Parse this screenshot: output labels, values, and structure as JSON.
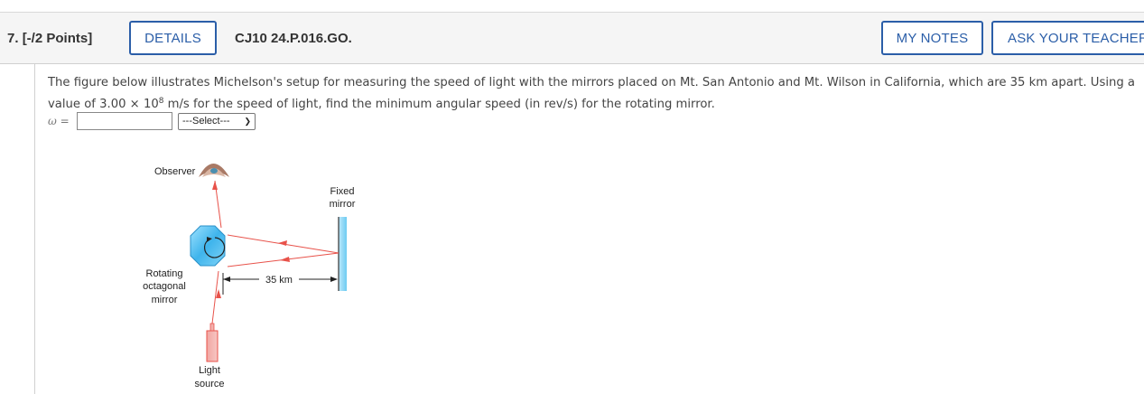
{
  "question": {
    "number": "7.",
    "points": "[-/2 Points]",
    "details_label": "DETAILS",
    "code": "CJ10 24.P.016.GO.",
    "my_notes_label": "MY NOTES",
    "ask_teacher_label": "ASK YOUR TEACHER"
  },
  "problem": {
    "text_a": "The figure below illustrates Michelson's setup for measuring the speed of light with the mirrors placed on Mt. San Antonio and Mt. Wilson in California, which are 35 km apart. Using a value of 3.00 ",
    "times": "×",
    "base": "10",
    "exponent": "8",
    "text_b": " m/s for the speed of light, find the minimum angular speed (in rev/s) for the rotating mirror."
  },
  "answer": {
    "symbol": "ω =",
    "value": "",
    "select_value": "---Select---"
  },
  "figure": {
    "observer_label": "Observer",
    "fixed_label_1": "Fixed",
    "fixed_label_2": "mirror",
    "rotating_label_1": "Rotating",
    "rotating_label_2": "octagonal",
    "rotating_label_3": "mirror",
    "distance_label": "35 km",
    "light_label_1": "Light",
    "light_label_2": "source",
    "beam_color": "#e8524a",
    "mirror_color": "#5bc0eb"
  }
}
